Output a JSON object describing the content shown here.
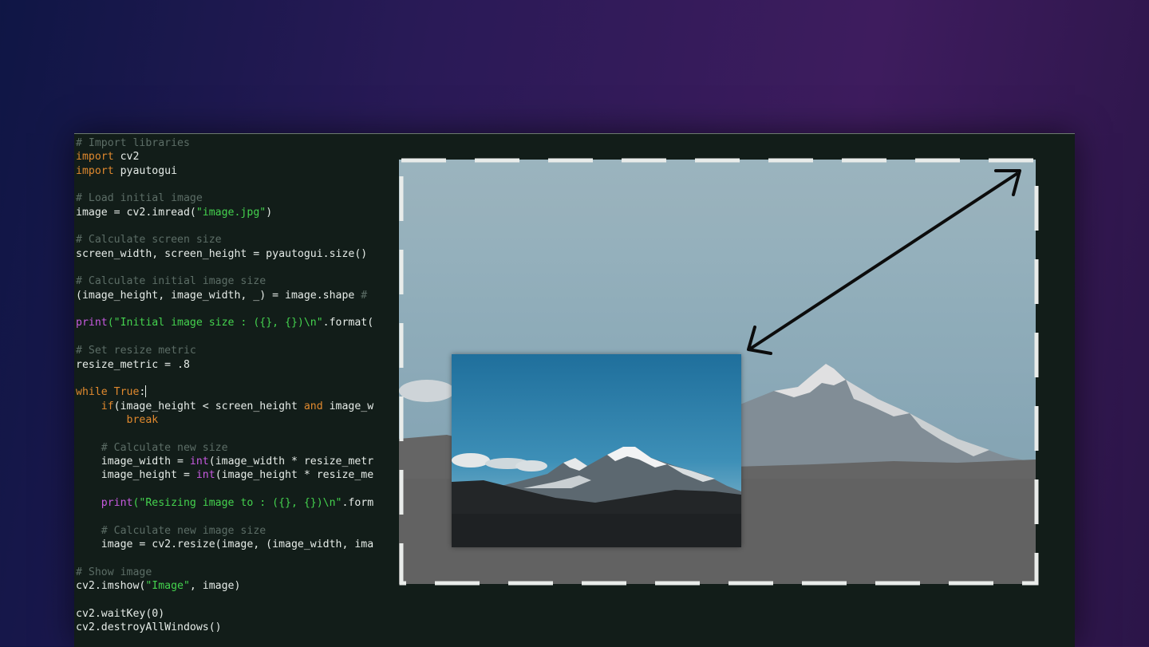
{
  "code": {
    "lines": [
      [
        {
          "t": "# Import libraries",
          "c": "cm"
        }
      ],
      [
        {
          "t": "import",
          "c": "kw"
        },
        {
          "t": " cv2"
        }
      ],
      [
        {
          "t": "import",
          "c": "kw"
        },
        {
          "t": " pyautogui"
        }
      ],
      [],
      [
        {
          "t": "# Load initial image",
          "c": "cm"
        }
      ],
      [
        {
          "t": "image = cv2.imread("
        },
        {
          "t": "\"image.jpg\"",
          "c": "st"
        },
        {
          "t": ")"
        }
      ],
      [],
      [
        {
          "t": "# Calculate screen size",
          "c": "cm"
        }
      ],
      [
        {
          "t": "screen_width, screen_height = pyautogui.size()"
        }
      ],
      [],
      [
        {
          "t": "# Calculate initial image size",
          "c": "cm"
        }
      ],
      [
        {
          "t": "(image_height, image_width, _) = image.shape "
        },
        {
          "t": "#",
          "c": "cm"
        }
      ],
      [],
      [
        {
          "t": "print",
          "c": "fn"
        },
        {
          "t": "(\"Initial image size : ({}, {})\\n\"",
          "c": "st"
        },
        {
          "t": ".format("
        }
      ],
      [],
      [
        {
          "t": "# Set resize metric",
          "c": "cm"
        }
      ],
      [
        {
          "t": "resize_metric = .8"
        }
      ],
      [],
      [
        {
          "t": "while",
          "c": "kw"
        },
        {
          "t": " "
        },
        {
          "t": "True",
          "c": "kw"
        },
        {
          "t": ":"
        },
        {
          "cursor": true
        }
      ],
      [
        {
          "t": "    "
        },
        {
          "t": "if",
          "c": "kw"
        },
        {
          "t": "(image_height < screen_height "
        },
        {
          "t": "and",
          "c": "kw"
        },
        {
          "t": " image_w"
        }
      ],
      [
        {
          "t": "        "
        },
        {
          "t": "break",
          "c": "kw"
        }
      ],
      [],
      [
        {
          "t": "    "
        },
        {
          "t": "# Calculate new size",
          "c": "cm"
        }
      ],
      [
        {
          "t": "    image_width = "
        },
        {
          "t": "int",
          "c": "fn"
        },
        {
          "t": "(image_width * resize_metr"
        }
      ],
      [
        {
          "t": "    image_height = "
        },
        {
          "t": "int",
          "c": "fn"
        },
        {
          "t": "(image_height * resize_me"
        }
      ],
      [],
      [
        {
          "t": "    "
        },
        {
          "t": "print",
          "c": "fn"
        },
        {
          "t": "(\"Resizing image to : ({}, {})\\n\"",
          "c": "st"
        },
        {
          "t": ".form"
        }
      ],
      [],
      [
        {
          "t": "    "
        },
        {
          "t": "# Calculate new image size",
          "c": "cm"
        }
      ],
      [
        {
          "t": "    image = cv2.resize(image, (image_width, ima"
        }
      ],
      [],
      [
        {
          "t": "# Show image",
          "c": "cm"
        }
      ],
      [
        {
          "t": "cv2.imshow("
        },
        {
          "t": "\"Image\"",
          "c": "st"
        },
        {
          "t": ", image)"
        }
      ],
      [],
      [
        {
          "t": "cv2.waitKey(0)"
        }
      ],
      [
        {
          "t": "cv2.destroyAllWindows()"
        }
      ]
    ]
  },
  "colors": {
    "comment": "#5c6d66",
    "keyword": "#e0892e",
    "string": "#44d24e",
    "builtin": "#c75ae0",
    "text": "#e6ece8",
    "editor_bg": "#121d19"
  },
  "icons": {
    "resize_arrow": "double-headed-diagonal-arrow-icon"
  }
}
